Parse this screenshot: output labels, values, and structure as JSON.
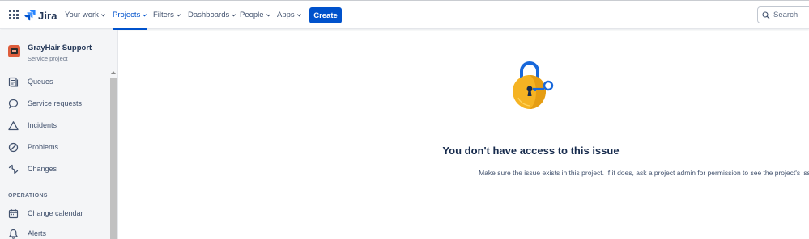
{
  "app": {
    "logo_text": "Jira",
    "brand_color": "#0052cc"
  },
  "nav": {
    "items": [
      {
        "label": "Your work",
        "active": false
      },
      {
        "label": "Projects",
        "active": true
      },
      {
        "label": "Filters",
        "active": false
      },
      {
        "label": "Dashboards",
        "active": false
      },
      {
        "label": "People",
        "active": false
      },
      {
        "label": "Apps",
        "active": false
      }
    ],
    "create_label": "Create",
    "search_placeholder": "Search"
  },
  "sidebar": {
    "project_name": "GrayHair Support",
    "project_type": "Service project",
    "items": [
      {
        "label": "Queues",
        "icon": "queues-icon"
      },
      {
        "label": "Service requests",
        "icon": "speech-bubble-icon"
      },
      {
        "label": "Incidents",
        "icon": "warning-triangle-icon"
      },
      {
        "label": "Problems",
        "icon": "prohibited-icon"
      },
      {
        "label": "Changes",
        "icon": "changes-icon"
      }
    ],
    "section_label": "OPERATIONS",
    "operations_items": [
      {
        "label": "Change calendar",
        "icon": "calendar-icon"
      },
      {
        "label": "Alerts",
        "icon": "bell-icon"
      }
    ]
  },
  "main": {
    "illustration": "padlock-with-key-icon",
    "title": "You don't have access to this issue",
    "message": "Make sure the issue exists in this project. If it does, ask a project admin for permission to see the project's issues."
  }
}
